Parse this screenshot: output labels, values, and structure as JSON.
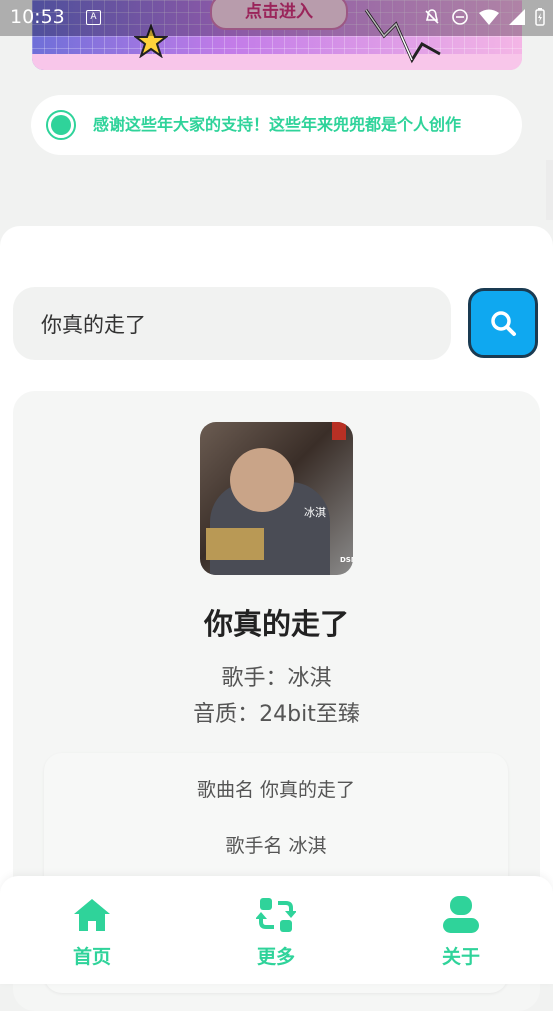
{
  "status_bar": {
    "time": "10:53",
    "notification_letter": "A"
  },
  "banner": {
    "enter_label": "点击进入"
  },
  "notice": {
    "text": "感谢这些年大家的支持！这些年来兜兜都是个人创作"
  },
  "search": {
    "value": "你真的走了",
    "placeholder": ""
  },
  "song": {
    "title": "你真的走了",
    "singer_line": "歌手：冰淇",
    "quality_line": "音质：24bit至臻",
    "cover_caption": "冰淇",
    "cover_mark": "DSD"
  },
  "details": {
    "song_name_line": "歌曲名 你真的走了",
    "singer_name_line": "歌手名 冰淇"
  },
  "nav": {
    "items": [
      {
        "label": "首页",
        "icon": "home-icon"
      },
      {
        "label": "更多",
        "icon": "refresh-icon"
      },
      {
        "label": "关于",
        "icon": "user-icon"
      }
    ]
  },
  "colors": {
    "accent": "#2fd39a",
    "search_button": "#0fa8f0",
    "banner_text": "#d6327d"
  }
}
